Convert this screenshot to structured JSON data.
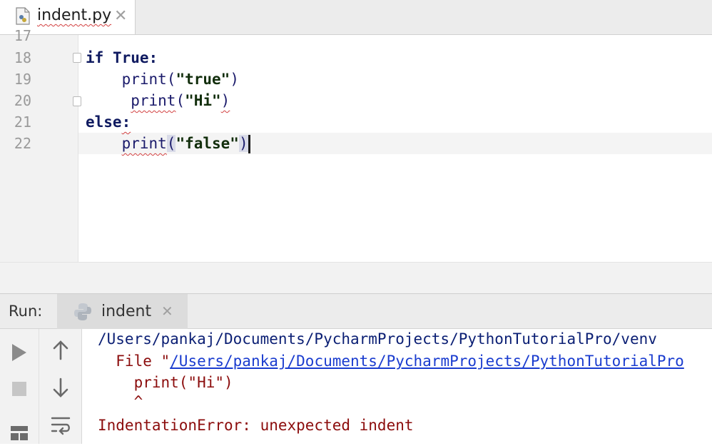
{
  "tab": {
    "filename": "indent.py",
    "close_glyph": "✕"
  },
  "editor": {
    "line_numbers": [
      "17",
      "18",
      "19",
      "20",
      "21",
      "22"
    ],
    "lines": {
      "l18": {
        "kw1": "if",
        "kw2": "True",
        "colon": ":"
      },
      "l19": {
        "indent": "    ",
        "fn": "print",
        "open": "(",
        "str": "\"true\"",
        "close": ")"
      },
      "l20": {
        "indent": "     ",
        "fn": "print",
        "open": "(",
        "str": "\"Hi\"",
        "close": ")"
      },
      "l21": {
        "kw": "else",
        "colon": ":"
      },
      "l22": {
        "indent": "    ",
        "fn": "print",
        "open": "(",
        "str": "\"false\"",
        "close": ")"
      }
    }
  },
  "run_panel": {
    "label": "Run:",
    "tab_label": "indent",
    "close_glyph": "✕",
    "output": {
      "line1": "/Users/pankaj/Documents/PycharmProjects/PythonTutorialPro/venv",
      "line2_prefix": "  File \"",
      "line2_link": "/Users/pankaj/Documents/PycharmProjects/PythonTutorialPro",
      "line3": "    print(\"Hi\")",
      "line4": "    ^",
      "line5": "IndentationError: unexpected indent"
    }
  },
  "colors": {
    "keyword": "#0f1a60",
    "error": "#8b0c0c",
    "link": "#1a3ccf",
    "run_green": "#4a9b3c"
  },
  "icons": [
    "python-file-icon",
    "close-icon",
    "fold-icon",
    "python-icon",
    "run-icon",
    "stop-icon",
    "up-arrow-icon",
    "down-arrow-icon",
    "soft-wrap-icon",
    "layout-icon"
  ]
}
